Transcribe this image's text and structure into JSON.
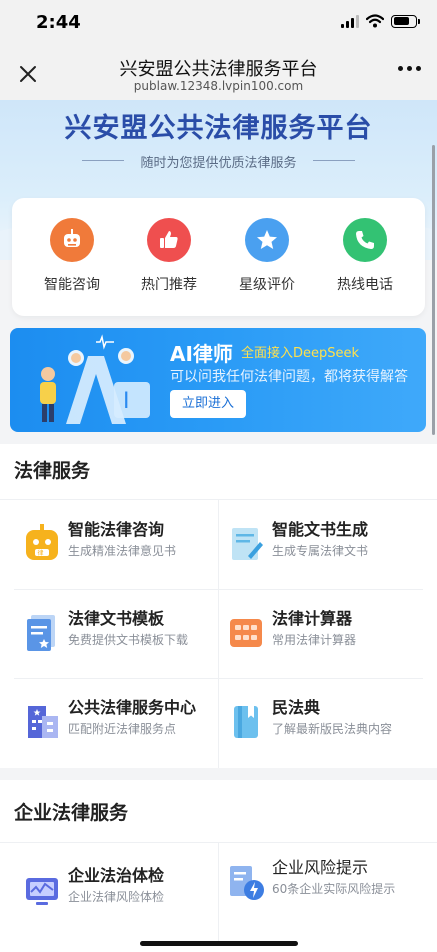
{
  "status_bar": {
    "time": "2:44"
  },
  "nav": {
    "title": "兴安盟公共法律服务平台",
    "url": "publaw.12348.lvpin100.com"
  },
  "hero": {
    "title": "兴安盟公共法律服务平台",
    "subtitle": "随时为您提供优质法律服务"
  },
  "quick": [
    {
      "label": "智能咨询",
      "color": "#f07a3a",
      "icon": "robot-icon"
    },
    {
      "label": "热门推荐",
      "color": "#ef4f4f",
      "icon": "thumbs-up-icon"
    },
    {
      "label": "星级评价",
      "color": "#4aa0f0",
      "icon": "star-icon"
    },
    {
      "label": "热线电话",
      "color": "#33c273",
      "icon": "phone-icon"
    }
  ],
  "banner": {
    "title": "AI律师",
    "tag": "全面接入DeepSeek",
    "desc": "可以问我任何法律问题，都将获得解答",
    "button": "立即进入"
  },
  "legal_services": {
    "title": "法律服务",
    "items": [
      {
        "name": "智能法律咨询",
        "desc": "生成精准法律意见书",
        "icon": "robot-icon"
      },
      {
        "name": "智能文书生成",
        "desc": "生成专属法律文书",
        "icon": "document-icon"
      },
      {
        "name": "法律文书模板",
        "desc": "免费提供文书模板下载",
        "icon": "template-icon"
      },
      {
        "name": "法律计算器",
        "desc": "常用法律计算器",
        "icon": "calculator-icon"
      },
      {
        "name": "公共法律服务中心",
        "desc": "匹配附近法律服务点",
        "icon": "building-icon"
      },
      {
        "name": "民法典",
        "desc": "了解最新版民法典内容",
        "icon": "book-icon"
      }
    ]
  },
  "enterprise_services": {
    "title": "企业法律服务",
    "items": [
      {
        "name": "企业法治体检",
        "desc": "企业法律风险体检",
        "icon": "monitor-icon"
      },
      {
        "name": "企业风险提示",
        "desc": "60条企业实际风险提示",
        "icon": "risk-alert-icon"
      }
    ]
  }
}
